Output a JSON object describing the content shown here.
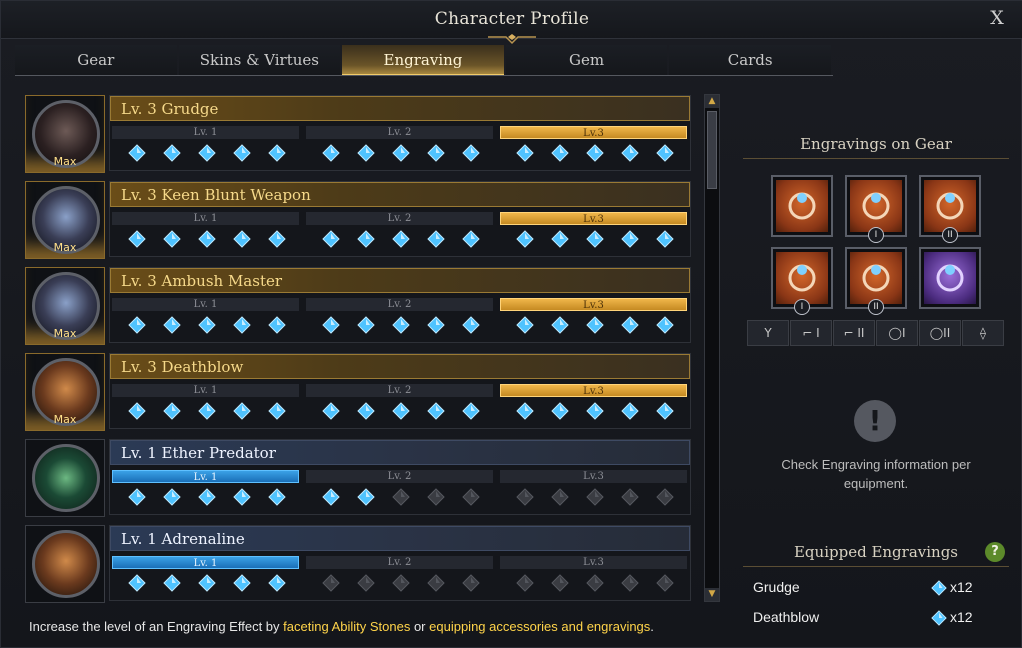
{
  "window": {
    "title": "Character Profile",
    "close_label": "X"
  },
  "tabs": [
    {
      "label": "Gear",
      "active": false
    },
    {
      "label": "Skins & Virtues",
      "active": false
    },
    {
      "label": "Engraving",
      "active": true
    },
    {
      "label": "Gem",
      "active": false
    },
    {
      "label": "Cards",
      "active": false
    }
  ],
  "engravings": [
    {
      "name": "Lv. 3 Grudge",
      "tier": "gold",
      "max_label": "Max",
      "levels": [
        "Lv. 1",
        "Lv. 2",
        "Lv.3"
      ],
      "active_level": 3,
      "filled_gems": 15,
      "emblem": "grudge"
    },
    {
      "name": "Lv. 3 Keen Blunt Weapon",
      "tier": "gold",
      "max_label": "Max",
      "levels": [
        "Lv. 1",
        "Lv. 2",
        "Lv.3"
      ],
      "active_level": 3,
      "filled_gems": 15,
      "emblem": "blue"
    },
    {
      "name": "Lv. 3 Ambush Master",
      "tier": "gold",
      "max_label": "Max",
      "levels": [
        "Lv. 1",
        "Lv. 2",
        "Lv.3"
      ],
      "active_level": 3,
      "filled_gems": 15,
      "emblem": "blue"
    },
    {
      "name": "Lv. 3 Deathblow",
      "tier": "gold",
      "max_label": "Max",
      "levels": [
        "Lv. 1",
        "Lv. 2",
        "Lv.3"
      ],
      "active_level": 3,
      "filled_gems": 15,
      "emblem": "orange"
    },
    {
      "name": "Lv. 1 Ether Predator",
      "tier": "blue",
      "max_label": "",
      "levels": [
        "Lv. 1",
        "Lv. 2",
        "Lv.3"
      ],
      "active_level": 1,
      "filled_gems": 7,
      "emblem": "green"
    },
    {
      "name": "Lv. 1 Adrenaline",
      "tier": "blue",
      "max_label": "",
      "levels": [
        "Lv. 1",
        "Lv. 2",
        "Lv.3"
      ],
      "active_level": 1,
      "filled_gems": 5,
      "emblem": "orange"
    }
  ],
  "footer": {
    "prefix": "Increase the level of an Engraving Effect by ",
    "link1": "faceting Ability Stones",
    "middle": " or ",
    "link2": "equipping accessories and engravings",
    "suffix": "."
  },
  "side": {
    "gear_heading": "Engravings on Gear",
    "slots": [
      {
        "icon": "necklace-icon",
        "badge": "",
        "color": "orange"
      },
      {
        "icon": "earring-icon",
        "badge": "I",
        "color": "orange"
      },
      {
        "icon": "earring-icon",
        "badge": "II",
        "color": "orange"
      },
      {
        "icon": "ring-icon",
        "badge": "I",
        "color": "orange"
      },
      {
        "icon": "ring-icon",
        "badge": "II",
        "color": "orange"
      },
      {
        "icon": "ability-stone-icon",
        "badge": "",
        "color": "purple"
      }
    ],
    "filters": [
      {
        "icon": "necklace-filter-icon",
        "label": "Y"
      },
      {
        "icon": "earring-1-filter-icon",
        "label": "⌐ I"
      },
      {
        "icon": "earring-2-filter-icon",
        "label": "⌐ II"
      },
      {
        "icon": "ring-1-filter-icon",
        "label": "◯I"
      },
      {
        "icon": "ring-2-filter-icon",
        "label": "◯II"
      },
      {
        "icon": "stone-filter-icon",
        "label": "⟠"
      }
    ],
    "info_icon": "!",
    "info_text": "Check Engraving information per equipment.",
    "equipped_heading": "Equipped Engravings",
    "help_label": "?",
    "equipped": [
      {
        "name": "Grudge",
        "count": "x12"
      },
      {
        "name": "Deathblow",
        "count": "x12"
      }
    ]
  },
  "colors": {
    "gold": "#f0b64a",
    "blue": "#3aa1e6",
    "gem": "#4fc3ff",
    "gem_empty": "#3a3c42"
  }
}
